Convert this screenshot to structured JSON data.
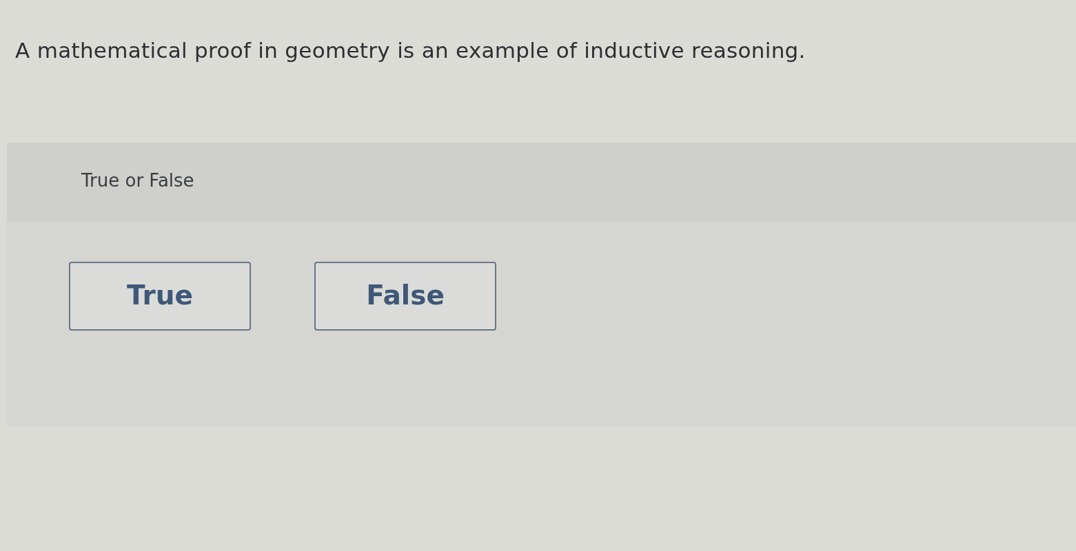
{
  "question": {
    "text": "A mathematical proof in geometry is an example of inductive reasoning."
  },
  "answer_panel": {
    "instruction": "True or False",
    "options": [
      {
        "label": "True"
      },
      {
        "label": "False"
      }
    ]
  }
}
